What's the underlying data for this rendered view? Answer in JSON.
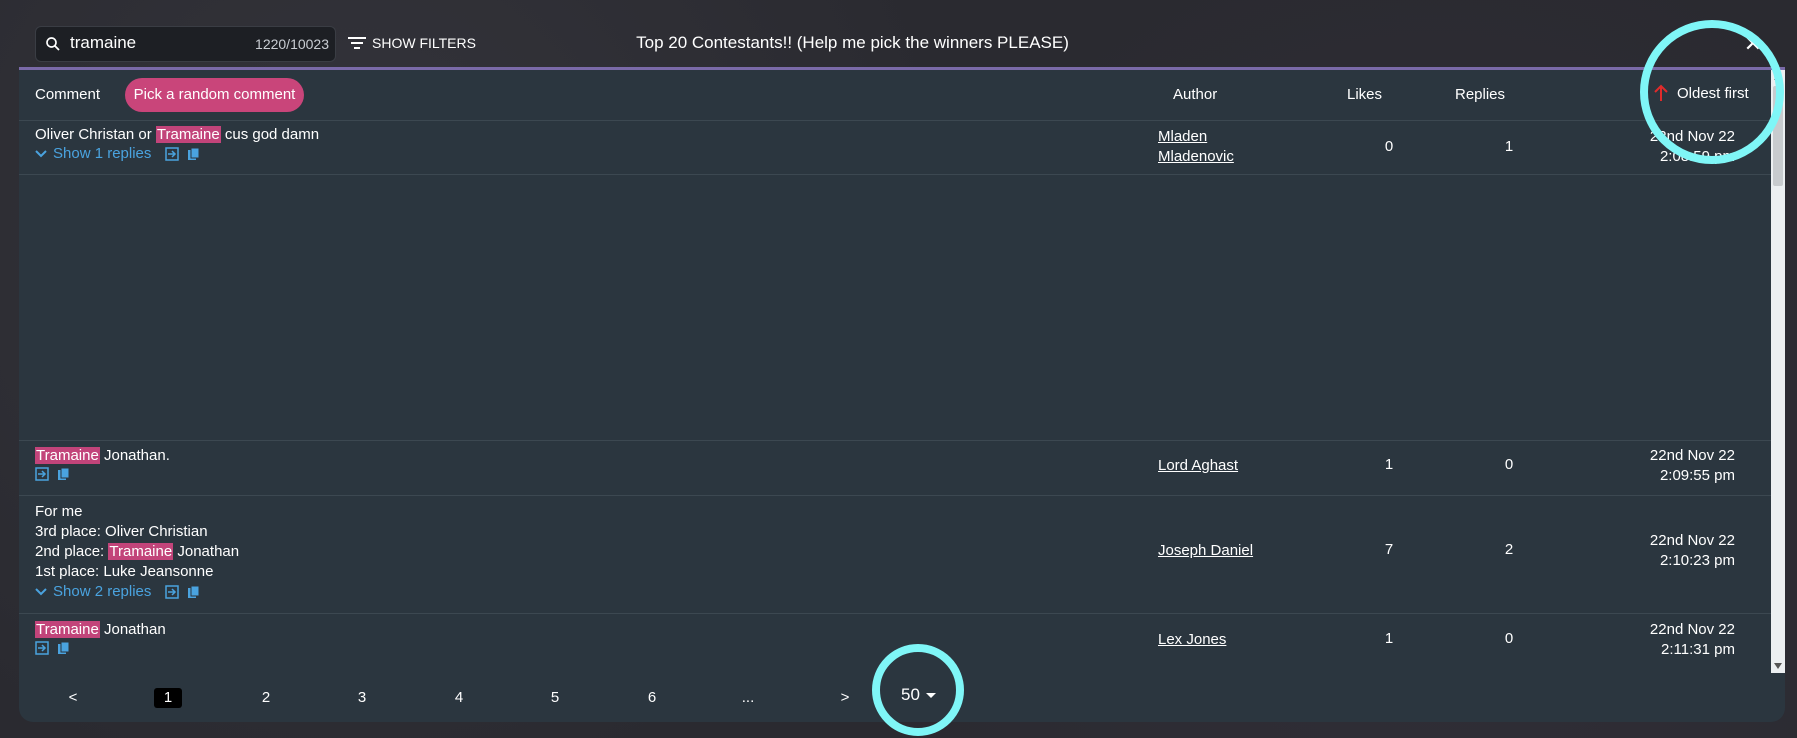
{
  "search": {
    "value": "tramaine",
    "count": "1220/10023"
  },
  "filters_label": "SHOW FILTERS",
  "title": "Top 20 Contestants!! (Help me pick the winners PLEASE)",
  "close_label": "✕",
  "header": {
    "comment": "Comment",
    "pick_random": "Pick a random comment",
    "author": "Author",
    "likes": "Likes",
    "replies": "Replies",
    "sort": "Oldest first"
  },
  "rows": [
    {
      "text_parts": [
        "Oliver Christan or ",
        "Tramaine",
        " cus god damn"
      ],
      "show_replies": "Show 1 replies",
      "author_line1": "Mladen",
      "author_line2": "Mladenovic",
      "likes": "0",
      "replies": "1",
      "date_line1": "22nd Nov 22",
      "date_line2": "2:08:59 pm"
    },
    {
      "text_parts": [
        "Tramaine",
        " Jonathan."
      ],
      "author": "Lord Aghast",
      "likes": "1",
      "replies": "0",
      "date_line1": "22nd Nov 22",
      "date_line2": "2:09:55 pm"
    },
    {
      "line1": "For me",
      "line2": "3rd place: Oliver Christian",
      "line3_parts": [
        "2nd place: ",
        "Tramaine",
        " Jonathan"
      ],
      "line4": "1st place: Luke Jeansonne",
      "show_replies": "Show 2 replies",
      "author": "Joseph Daniel",
      "likes": "7",
      "replies": "2",
      "date_line1": "22nd Nov 22",
      "date_line2": "2:10:23 pm"
    },
    {
      "text_parts": [
        "Tramaine",
        " Jonathan"
      ],
      "author": "Lex Jones",
      "likes": "1",
      "replies": "0",
      "date_line1": "22nd Nov 22",
      "date_line2": "2:11:31 pm"
    }
  ],
  "pagination": {
    "prev": "<",
    "pages": [
      "1",
      "2",
      "3",
      "4",
      "5",
      "6",
      "..."
    ],
    "next": ">",
    "per_page": "50"
  },
  "colors": {
    "highlight": "#c2447a",
    "accent": "#7ff6f7",
    "link": "#4aa3df",
    "sort_arrow": "#e02b2b"
  }
}
